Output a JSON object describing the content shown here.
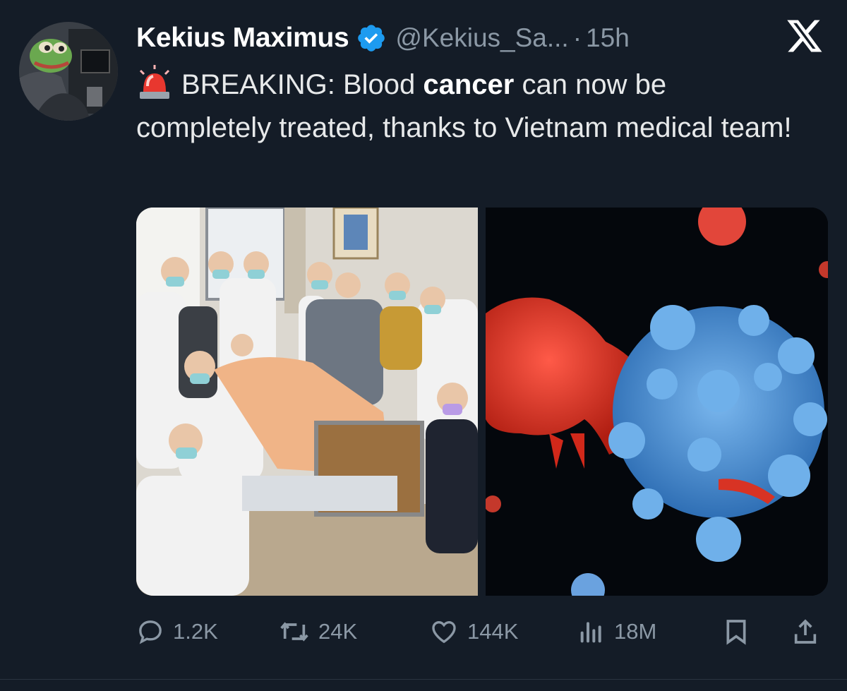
{
  "author": {
    "name": "Kekius Maximus",
    "handle": "@Kekius_Sa...",
    "separator": "·",
    "time": "15h",
    "verified": true,
    "avatar_icon": "frog-avatar"
  },
  "tweet": {
    "emoji": "rotating-light",
    "text_before": "BREAKING: Blood ",
    "text_bold": "cancer",
    "text_after": " can now be completely treated, thanks to Vietnam medical team!"
  },
  "media": [
    {
      "kind": "photo",
      "subject": "hospital-group-photo"
    },
    {
      "kind": "photo",
      "subject": "cell-illustration"
    }
  ],
  "actions": {
    "replies": "1.2K",
    "reposts": "24K",
    "likes": "144K",
    "views": "18M"
  },
  "colors": {
    "background": "#141c27",
    "muted": "#8b98a5",
    "verified": "#1d9bf0"
  }
}
